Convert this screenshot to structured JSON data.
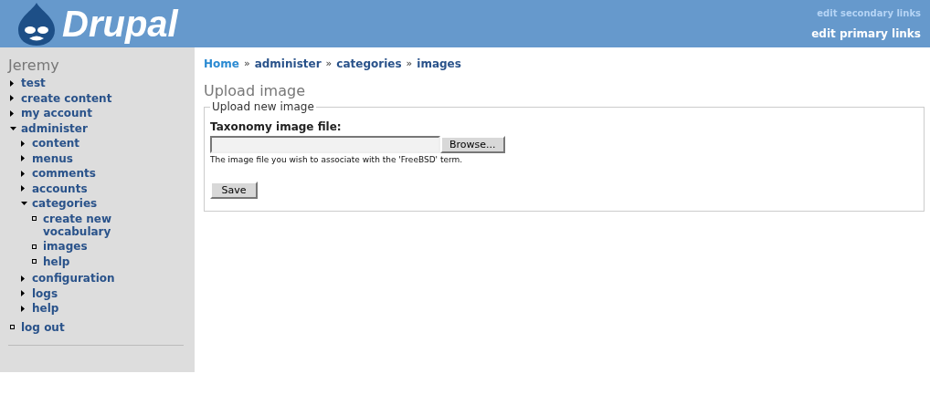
{
  "header": {
    "logo_text": "Drupal",
    "secondary_links": [
      "edit secondary links"
    ],
    "primary_links": [
      "edit primary links"
    ]
  },
  "sidebar": {
    "title": "Jeremy",
    "items": [
      {
        "label": "test",
        "kind": "collapsed"
      },
      {
        "label": "create content",
        "kind": "collapsed"
      },
      {
        "label": "my account",
        "kind": "collapsed"
      },
      {
        "label": "administer",
        "kind": "expanded",
        "children": [
          {
            "label": "content",
            "kind": "collapsed"
          },
          {
            "label": "menus",
            "kind": "collapsed"
          },
          {
            "label": "comments",
            "kind": "collapsed"
          },
          {
            "label": "accounts",
            "kind": "collapsed"
          },
          {
            "label": "categories",
            "kind": "expanded",
            "children": [
              {
                "label": "create new vocabulary",
                "kind": "leaf"
              },
              {
                "label": "images",
                "kind": "leaf"
              },
              {
                "label": "help",
                "kind": "leaf"
              }
            ]
          },
          {
            "label": "configuration",
            "kind": "collapsed"
          },
          {
            "label": "logs",
            "kind": "collapsed"
          },
          {
            "label": "help",
            "kind": "collapsed"
          }
        ]
      },
      {
        "label": "log out",
        "kind": "leaf"
      }
    ]
  },
  "breadcrumb": [
    {
      "label": "Home",
      "color": "#2a8ad2"
    },
    {
      "label": "administer",
      "color": "#29528a"
    },
    {
      "label": "categories",
      "color": "#29528a"
    },
    {
      "label": "images",
      "color": "#29528a"
    }
  ],
  "breadcrumb_separator": "»",
  "page_title": "Upload image",
  "fieldset": {
    "legend": "Upload new image",
    "label": "Taxonomy image file:",
    "browse_button": "Browse...",
    "description": "The image file you wish to associate with the 'FreeBSD' term.",
    "submit": "Save"
  }
}
